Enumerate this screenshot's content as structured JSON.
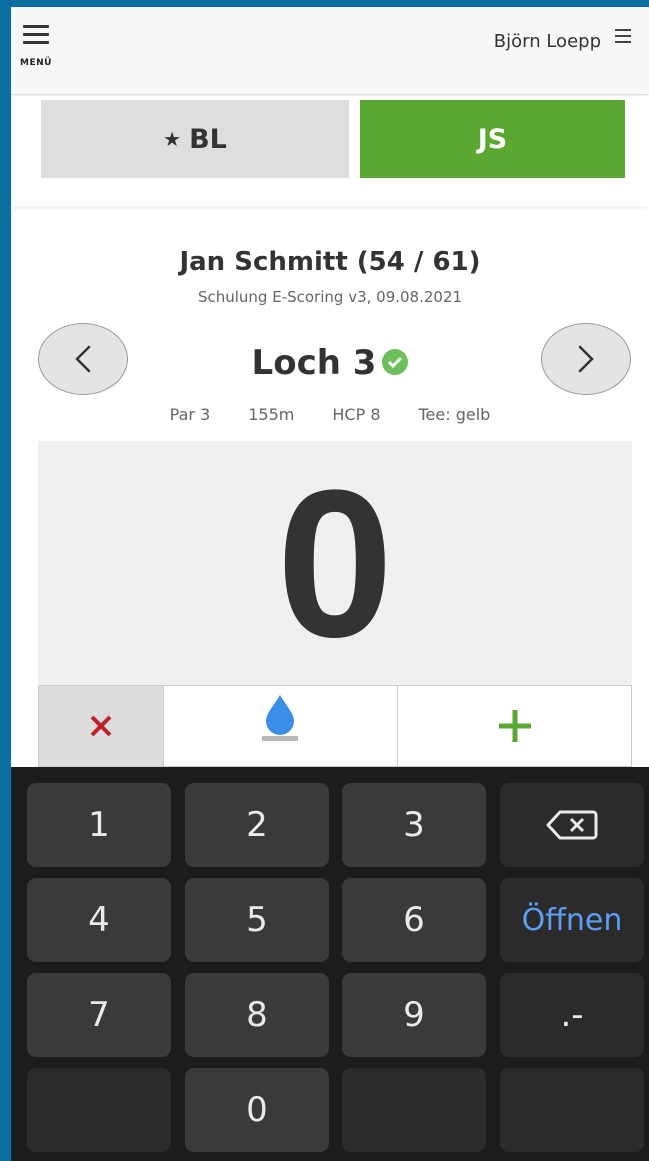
{
  "topbar": {
    "menu_label": "MENÜ",
    "user_name": "Björn Loepp"
  },
  "players": {
    "tab1_label": "BL",
    "tab2_label": "JS"
  },
  "player": {
    "title": "Jan Schmitt (54 / 61)",
    "subtitle": "Schulung E-Scoring v3, 09.08.2021"
  },
  "hole": {
    "title": "Loch 3",
    "par": "Par 3",
    "distance": "155m",
    "hcp": "HCP 8",
    "tee": "Tee: gelb"
  },
  "score": {
    "value": "0"
  },
  "keyboard": {
    "keys": [
      "1",
      "2",
      "3",
      "4",
      "5",
      "6",
      "Öffnen",
      "7",
      "8",
      "9",
      ".-",
      "0"
    ]
  },
  "colors": {
    "accent_green": "#5aa832",
    "minus_red": "#c0202a",
    "drop_blue": "#3b8ee8",
    "keyboard_blue": "#5c9df2"
  },
  "icons": {
    "menu": "hamburger-icon",
    "prev": "chevron-left-icon",
    "next": "chevron-right-icon",
    "check": "check-circle-icon",
    "drop": "water-drop-icon",
    "backspace": "backspace-icon"
  }
}
